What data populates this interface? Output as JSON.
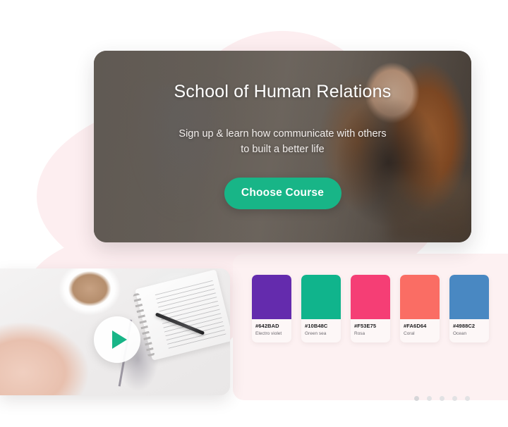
{
  "theme": {
    "accent_green": "#18B587",
    "blob_pink": "#FDEEF0",
    "panel_pink": "#FDF1F2",
    "page_background": "#FFFFFF",
    "dot_gray": "#E2E2E4"
  },
  "hero": {
    "title": "School of Human Relations",
    "subtitle": "Sign up & learn how communicate with others to built a better life",
    "cta_label": "Choose Course"
  },
  "video_card": {
    "play_icon": "play-triangle-icon",
    "alt": "Flat-lay photo of coffee cup, knitted blanket, notebook and pen"
  },
  "palette": {
    "swatches": [
      {
        "hex": "#642BAD",
        "name": "Electro violet"
      },
      {
        "hex": "#10B48C",
        "name": "Green sea"
      },
      {
        "hex": "#F53E75",
        "name": "Rosa"
      },
      {
        "hex": "#FA6D64",
        "name": "Coral"
      },
      {
        "hex": "#4988C2",
        "name": "Ocean"
      }
    ]
  },
  "pagination": {
    "count": 5,
    "active_index": 0,
    "dots": [
      "1",
      "2",
      "3",
      "4",
      "5"
    ]
  }
}
